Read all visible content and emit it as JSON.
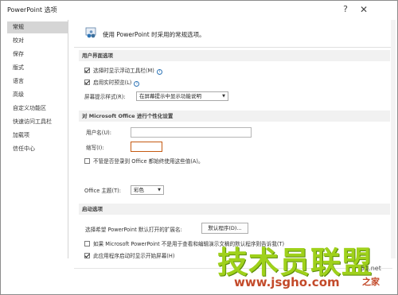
{
  "window": {
    "title": "PowerPoint 选项",
    "help_glyph": "?",
    "close_glyph": "✕"
  },
  "sidebar": {
    "items": [
      {
        "label": "常规",
        "active": true
      },
      {
        "label": "校对"
      },
      {
        "label": "保存"
      },
      {
        "label": "版式"
      },
      {
        "label": "语言"
      },
      {
        "label": "高级"
      },
      {
        "label": "自定义功能区"
      },
      {
        "label": "快速访问工具栏"
      },
      {
        "label": "加载项"
      },
      {
        "label": "信任中心"
      }
    ]
  },
  "main": {
    "header_text": "使用 PowerPoint 时采用的常规选项。",
    "ui_section": {
      "title": "用户界面选项",
      "show_mini_toolbar": {
        "label": "选择时显示浮动工具栏(M)",
        "checked": true
      },
      "enable_live_preview": {
        "label": "启用实时预览(L)",
        "checked": true
      },
      "screentip_label": "屏幕提示样式(R):",
      "screentip_value": "在屏幕提示中显示功能说明"
    },
    "personalize_section": {
      "title": "对 Microsoft Office 进行个性化设置",
      "username_label": "用户名(U):",
      "username_value": "",
      "initials_label": "缩写(I):",
      "initials_value": "",
      "always_use_label": "不管是否登录到 Office 都始终使用这些值(A)。",
      "always_use_checked": false,
      "theme_label": "Office 主题(T):",
      "theme_value": "彩色"
    },
    "startup_section": {
      "title": "启动选项",
      "ext_label": "选择希望 PowerPoint 默认打开的扩展名:",
      "default_programs_button": "默认程序(D)...",
      "not_default_label": "如果 Microsoft PowerPoint 不是用于查看和编辑演示文稿的默认程序则告诉我(T)",
      "not_default_checked": false,
      "show_start_label": "此应用程序启动时显示开始屏幕(H)",
      "show_start_checked": true
    }
  },
  "watermark": {
    "text": "技术员联盟",
    "url": "www.jsgho.com",
    "small": "51.net",
    "pc": "之家"
  },
  "colors": {
    "watermark_green": "#9fd11b",
    "watermark_red": "#c34a2a",
    "focus_border": "#c55a11"
  }
}
